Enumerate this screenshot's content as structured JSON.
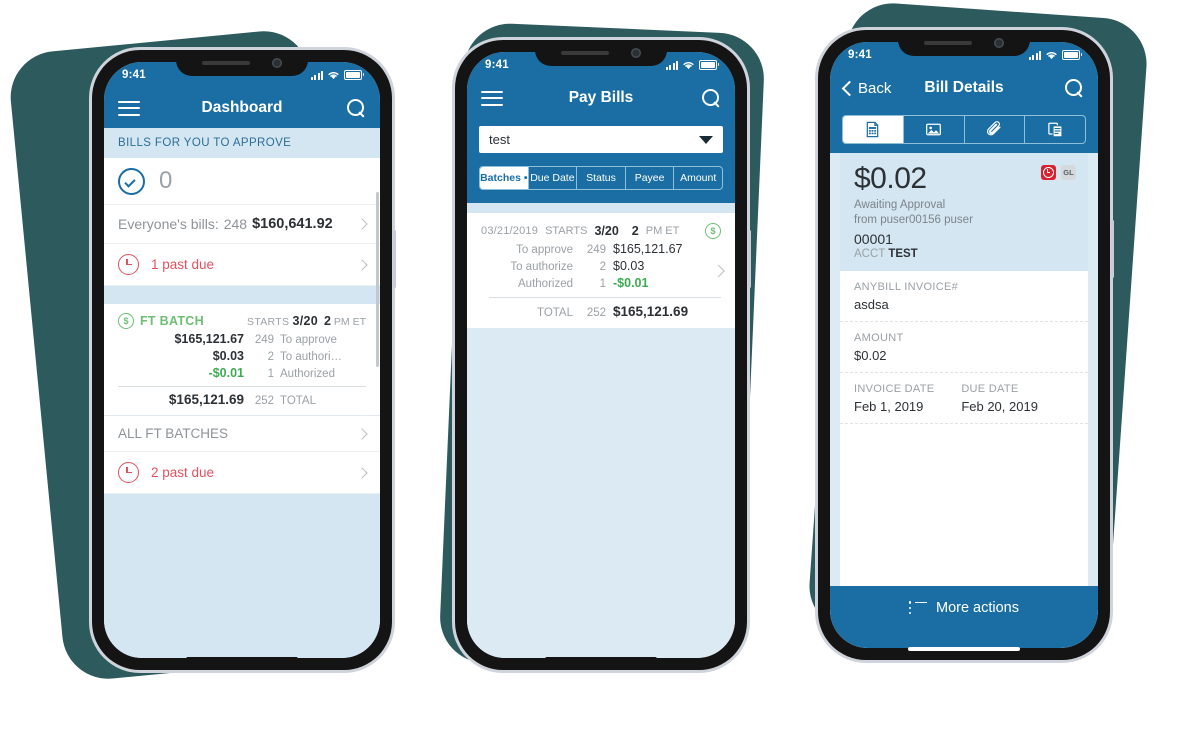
{
  "theme": {
    "brand_blue": "#1a6ea3",
    "teal_backdrop": "#2d5a5c",
    "light_blue": "#d3e6f2",
    "screen_bg": "#dceaf4",
    "green": "#3dab52",
    "green_soft": "#6dbf73",
    "red": "#e05260",
    "badge_red": "#d72231"
  },
  "phones": {
    "one": {
      "status": {
        "time": "9:41",
        "signal_icon": "signal-bars-icon",
        "wifi_icon": "wifi-icon",
        "battery_icon": "battery-icon"
      },
      "nav": {
        "menu_icon": "hamburger-menu-icon",
        "title": "Dashboard",
        "search_icon": "search-icon"
      },
      "section_header": "BILLS FOR YOU TO APPROVE",
      "approve": {
        "icon": "check-circle-icon",
        "count": "0"
      },
      "everyone": {
        "label": "Everyone's bills:",
        "count": "248",
        "amount": "$160,641.92",
        "chevron_icon": "chevron-right-icon"
      },
      "past_due_top": {
        "icon": "clock-icon",
        "label": "1 past due",
        "chevron_icon": "chevron-right-icon"
      },
      "batch": {
        "icon": "dollar-circle-icon",
        "name": "FT BATCH",
        "starts_label": "STARTS",
        "starts_date": "3/20",
        "time_value": "2",
        "time_unit": "PM ET",
        "lines": [
          {
            "amount": "$165,121.67",
            "count": "249",
            "label": "To approve",
            "green": false
          },
          {
            "amount": "$0.03",
            "count": "2",
            "label": "To authori…",
            "green": false
          },
          {
            "amount": "-$0.01",
            "count": "1",
            "label": "Authorized",
            "green": true
          }
        ],
        "total": {
          "amount": "$165,121.69",
          "count": "252",
          "label": "TOTAL"
        }
      },
      "all_batches": {
        "label": "ALL FT BATCHES",
        "chevron_icon": "chevron-right-icon"
      },
      "past_due_bottom": {
        "icon": "clock-icon",
        "label": "2 past due",
        "chevron_icon": "chevron-right-icon"
      }
    },
    "two": {
      "status": {
        "time": "9:41"
      },
      "nav": {
        "menu_icon": "hamburger-menu-icon",
        "title": "Pay Bills",
        "search_icon": "search-icon"
      },
      "dropdown": {
        "value": "test",
        "placeholder": "test",
        "caret_icon": "caret-down-icon"
      },
      "segments": [
        {
          "label": "Batches •",
          "active": true
        },
        {
          "label": "Due Date",
          "active": false
        },
        {
          "label": "Status",
          "active": false
        },
        {
          "label": "Payee",
          "active": false
        },
        {
          "label": "Amount",
          "active": false
        }
      ],
      "batch": {
        "date": "03/21/2019",
        "starts_label": "STARTS",
        "starts_date": "3/20",
        "time_value": "2",
        "time_unit": "PM ET",
        "icon": "dollar-circle-icon",
        "chevron_icon": "chevron-right-icon",
        "lines": [
          {
            "label": "To approve",
            "count": "249",
            "amount": "$165,121.67",
            "green": false
          },
          {
            "label": "To authorize",
            "count": "2",
            "amount": "$0.03",
            "green": false
          },
          {
            "label": "Authorized",
            "count": "1",
            "amount": "-$0.01",
            "green": true
          }
        ],
        "total": {
          "label": "TOTAL",
          "count": "252",
          "amount": "$165,121.69"
        }
      }
    },
    "three": {
      "status": {
        "time": "9:41"
      },
      "nav": {
        "back_icon": "chevron-left-icon",
        "back_label": "Back",
        "title": "Bill Details",
        "search_icon": "search-icon"
      },
      "tabs": [
        {
          "icon": "document-icon",
          "active": true
        },
        {
          "icon": "image-icon",
          "active": false
        },
        {
          "icon": "paperclip-icon",
          "active": false
        },
        {
          "icon": "copies-icon",
          "active": false
        }
      ],
      "summary": {
        "amount": "$0.02",
        "status": "Awaiting Approval",
        "from": "from puser00156 puser",
        "number": "00001",
        "acct_label": "ACCT",
        "acct_value": "TEST",
        "badges": [
          {
            "name": "overdue-clock-badge",
            "text": "",
            "kind": "red"
          },
          {
            "name": "gl-badge",
            "text": "GL",
            "kind": "gray"
          }
        ]
      },
      "fields": [
        {
          "label": "ANYBILL INVOICE#",
          "value": "asdsa"
        },
        {
          "label": "AMOUNT",
          "value": "$0.02"
        }
      ],
      "dates": [
        {
          "label": "INVOICE DATE",
          "value": "Feb 1, 2019"
        },
        {
          "label": "DUE DATE",
          "value": "Feb 20, 2019"
        }
      ],
      "footer": {
        "icon": "list-icon",
        "label": "More actions"
      }
    }
  }
}
